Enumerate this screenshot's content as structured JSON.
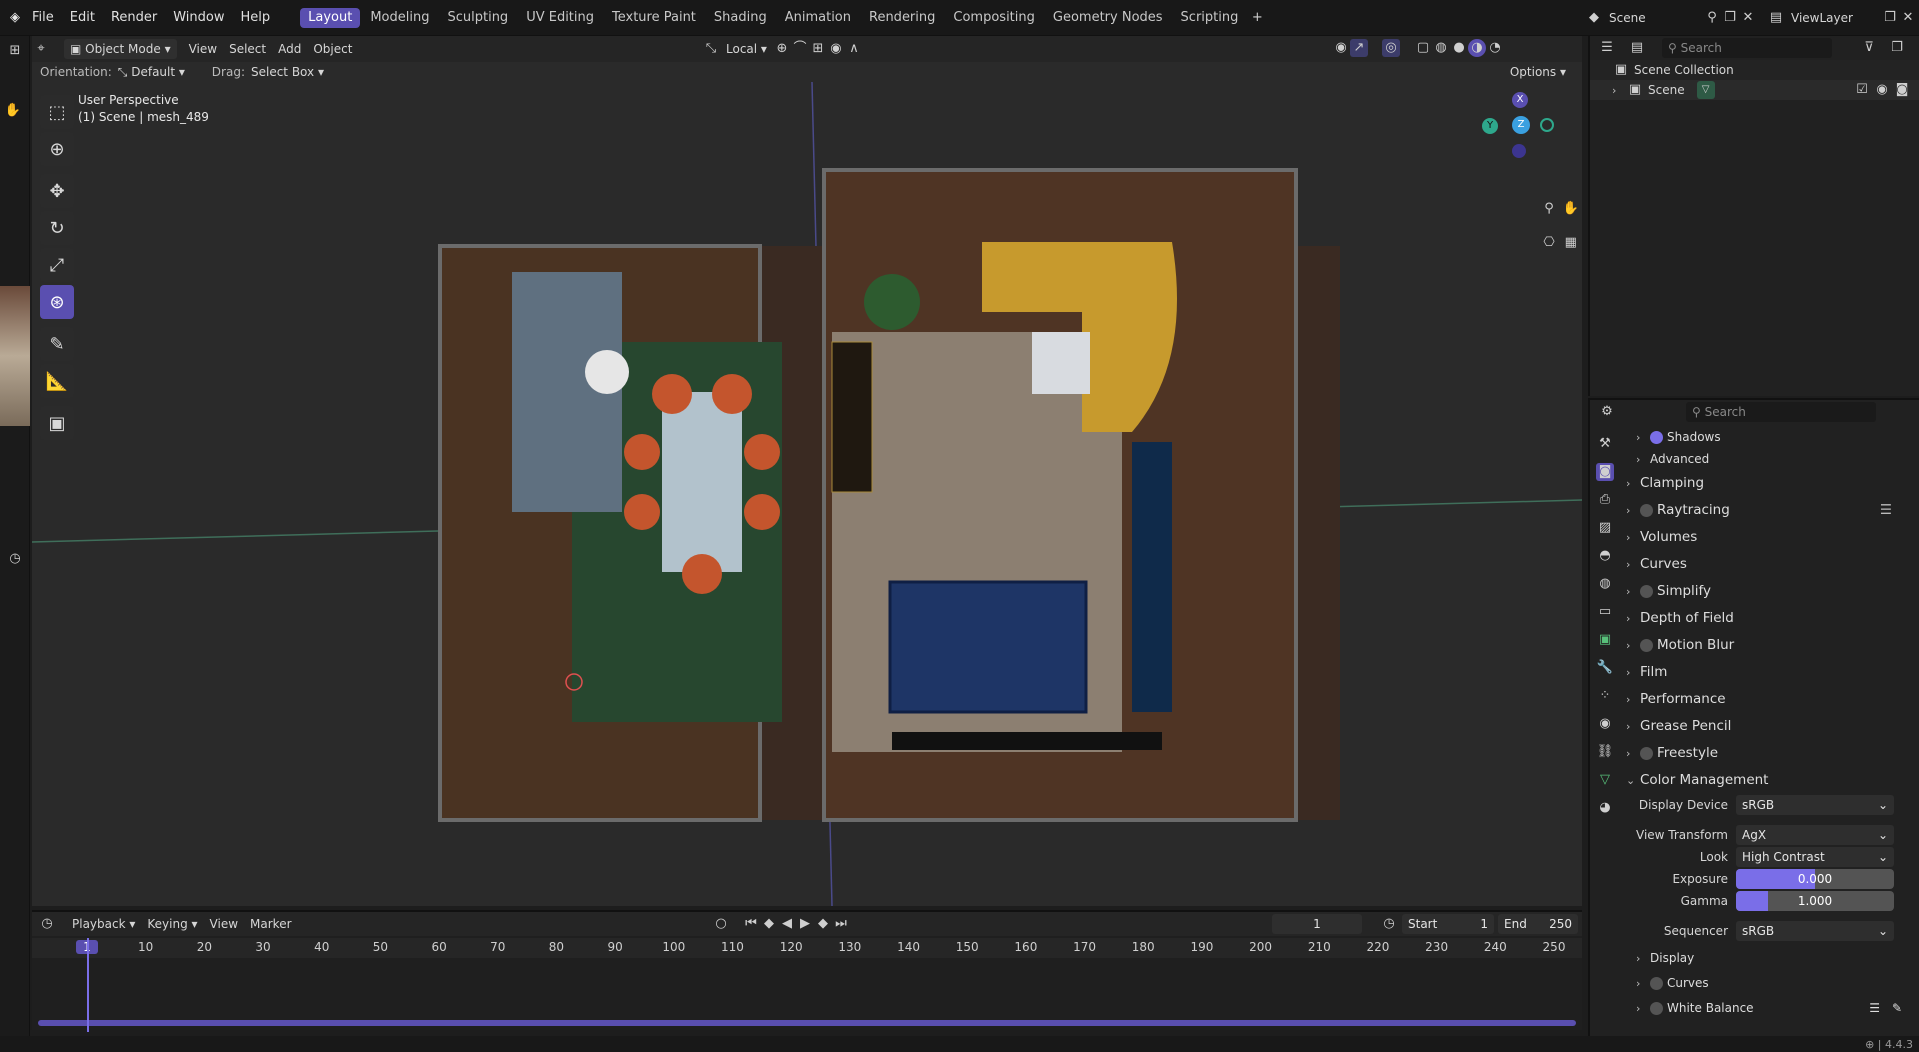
{
  "topbar": {
    "menus": [
      "File",
      "Edit",
      "Render",
      "Window",
      "Help"
    ],
    "workspaces": [
      "Layout",
      "Modeling",
      "Sculpting",
      "UV Editing",
      "Texture Paint",
      "Shading",
      "Animation",
      "Rendering",
      "Compositing",
      "Geometry Nodes",
      "Scripting"
    ],
    "active_workspace": "Layout",
    "scene_label": "Scene",
    "viewlayer_label": "ViewLayer"
  },
  "viewport_header": {
    "mode": "Object Mode",
    "menus": [
      "View",
      "Select",
      "Add",
      "Object"
    ],
    "transform_orientation": "Local",
    "orientation_label": "Orientation:",
    "orientation_value": "Default",
    "drag_label": "Drag:",
    "drag_value": "Select Box",
    "options_label": "Options"
  },
  "viewport": {
    "perspective_label": "User Perspective",
    "object_label": "(1) Scene | mesh_489",
    "gizmo": {
      "x": "X",
      "y": "Y",
      "z": "Z"
    }
  },
  "toolbar_tools": [
    "select-box-tool",
    "cursor-tool",
    "move-tool",
    "rotate-tool",
    "scale-tool",
    "transform-tool",
    "annotate-tool",
    "measure-tool",
    "add-cube-tool"
  ],
  "outliner": {
    "search_placeholder": "Search",
    "collection": "Scene Collection",
    "scene_item": "Scene"
  },
  "properties": {
    "search_placeholder": "Search",
    "sections_top": [
      {
        "label": "Shadows",
        "checkbox": true,
        "sub": true
      },
      {
        "label": "Advanced",
        "checkbox": false,
        "sub": true
      }
    ],
    "sections": [
      {
        "label": "Clamping",
        "checkbox": false
      },
      {
        "label": "Raytracing",
        "checkbox": true
      },
      {
        "label": "Volumes",
        "checkbox": false
      },
      {
        "label": "Curves",
        "checkbox": false
      },
      {
        "label": "Simplify",
        "checkbox": true
      },
      {
        "label": "Depth of Field",
        "checkbox": false
      },
      {
        "label": "Motion Blur",
        "checkbox": true
      },
      {
        "label": "Film",
        "checkbox": false
      },
      {
        "label": "Performance",
        "checkbox": false
      },
      {
        "label": "Grease Pencil",
        "checkbox": false
      },
      {
        "label": "Freestyle",
        "checkbox": true
      }
    ],
    "color_management": {
      "label": "Color Management",
      "display_device_label": "Display Device",
      "display_device": "sRGB",
      "view_transform_label": "View Transform",
      "view_transform": "AgX",
      "look_label": "Look",
      "look": "High Contrast",
      "exposure_label": "Exposure",
      "exposure": "0.000",
      "gamma_label": "Gamma",
      "gamma": "1.000",
      "sequencer_label": "Sequencer",
      "sequencer": "sRGB",
      "subsections": [
        "Display",
        "Curves",
        "White Balance"
      ]
    }
  },
  "timeline": {
    "menus": [
      "Playback",
      "Keying",
      "View",
      "Marker"
    ],
    "current_frame": "1",
    "start_label": "Start",
    "start": "1",
    "end_label": "End",
    "end": "250",
    "ticks": [
      "1",
      "10",
      "20",
      "30",
      "40",
      "50",
      "60",
      "70",
      "80",
      "90",
      "100",
      "110",
      "120",
      "130",
      "140",
      "150",
      "160",
      "170",
      "180",
      "190",
      "200",
      "210",
      "220",
      "230",
      "240",
      "250"
    ]
  },
  "statusbar": {
    "version": "4.4.3"
  },
  "colors": {
    "accent": "#5a4fb0",
    "slider_fill": "#7a6ee8",
    "bg": "#1d1d1d"
  }
}
